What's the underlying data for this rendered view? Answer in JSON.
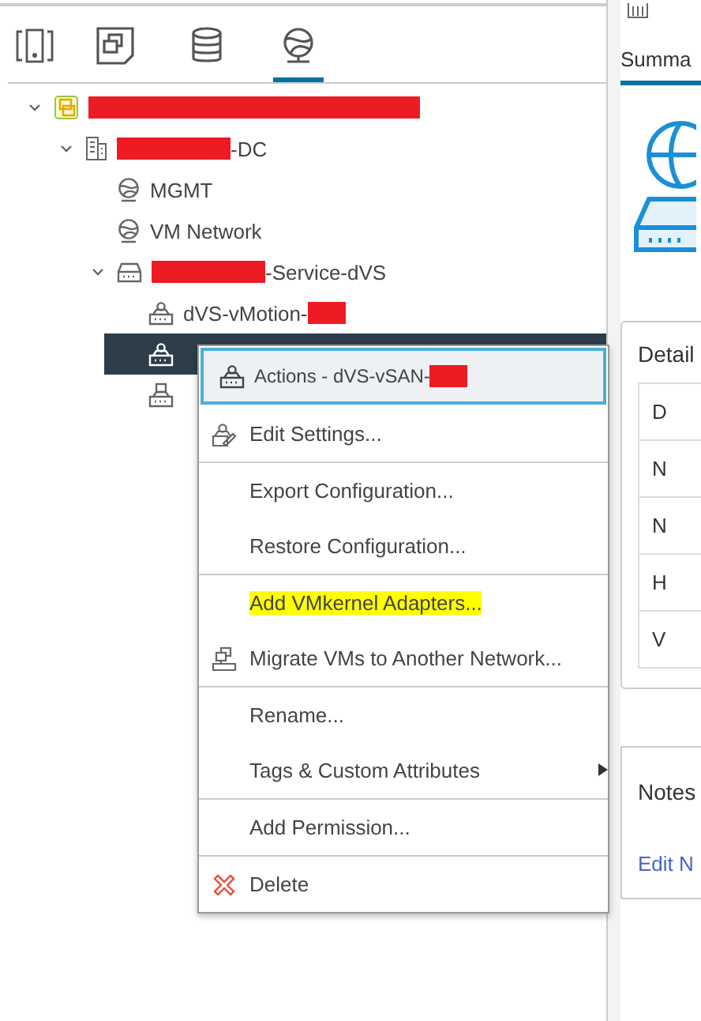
{
  "nav_tabs": [
    {
      "kind": "hosts",
      "selected": false
    },
    {
      "kind": "vms",
      "selected": false
    },
    {
      "kind": "storage",
      "selected": false
    },
    {
      "kind": "network",
      "selected": true
    }
  ],
  "tree": [
    {
      "kind": "vcenter",
      "expanded": true,
      "selected": false,
      "parts": [
        {
          "kind": "long_redaction"
        }
      ],
      "children": [
        {
          "kind": "datacenter",
          "expanded": true,
          "selected": false,
          "parts": [
            {
              "kind": "medium_redaction"
            },
            {
              "kind": "text",
              "text": "-DC"
            }
          ],
          "children": [
            {
              "kind": "network",
              "selected": false,
              "parts": [
                {
                  "kind": "text",
                  "text": "MGMT"
                }
              ]
            },
            {
              "kind": "network",
              "selected": false,
              "parts": [
                {
                  "kind": "text",
                  "text": "VM Network"
                }
              ]
            },
            {
              "kind": "switch",
              "expanded": true,
              "selected": false,
              "parts": [
                {
                  "kind": "medium_redaction"
                },
                {
                  "kind": "text",
                  "text": "-Service-dVS"
                }
              ],
              "children": [
                {
                  "kind": "portgroup",
                  "selected": false,
                  "parts": [
                    {
                      "kind": "text",
                      "text": "dVS-vMotion-"
                    },
                    {
                      "kind": "short_redaction"
                    }
                  ]
                },
                {
                  "kind": "portgroup",
                  "selected": true
                },
                {
                  "kind": "uplink",
                  "selected": false
                }
              ]
            }
          ]
        }
      ]
    }
  ],
  "context_menu": {
    "header": {
      "parts": [
        {
          "kind": "text",
          "text": "Actions - dVS-vSAN-"
        },
        {
          "kind": "short_redaction"
        }
      ]
    },
    "items": [
      {
        "kind": "edit",
        "label": "Edit Settings...",
        "highlighted": false,
        "submenu": false
      },
      {
        "kind": "separator"
      },
      {
        "kind": "plain",
        "label": "Export Configuration...",
        "highlighted": false,
        "submenu": false
      },
      {
        "kind": "plain",
        "label": "Restore Configuration...",
        "highlighted": false,
        "submenu": false
      },
      {
        "kind": "separator"
      },
      {
        "kind": "plain",
        "label": "Add VMkernel Adapters...",
        "highlighted": true,
        "submenu": false
      },
      {
        "kind": "migrate",
        "label": "Migrate VMs to Another Network...",
        "highlighted": false,
        "submenu": false
      },
      {
        "kind": "separator"
      },
      {
        "kind": "plain",
        "label": "Rename...",
        "highlighted": false,
        "submenu": false
      },
      {
        "kind": "plain",
        "label": "Tags & Custom Attributes",
        "highlighted": false,
        "submenu": true
      },
      {
        "kind": "separator"
      },
      {
        "kind": "plain",
        "label": "Add Permission...",
        "highlighted": false,
        "submenu": false
      },
      {
        "kind": "separator"
      },
      {
        "kind": "delete",
        "label": "Delete",
        "highlighted": false,
        "submenu": false
      }
    ]
  },
  "summary_panel": {
    "tabs": [
      {
        "label": "Summa",
        "selected": true
      }
    ],
    "details": {
      "title": "Detail",
      "rows": [
        "D",
        "N",
        "N",
        "H",
        "V"
      ]
    },
    "notes": {
      "title": "Notes",
      "link": "Edit N"
    }
  }
}
